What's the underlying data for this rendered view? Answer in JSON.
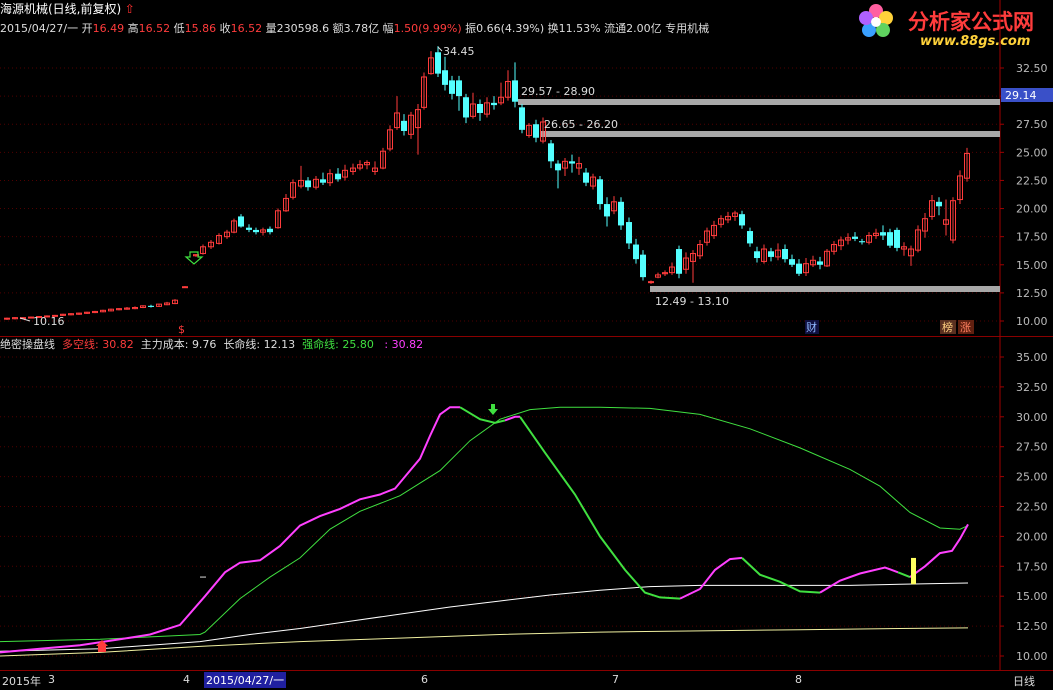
{
  "header": {
    "stock_title": "海源机械(日线,前复权)",
    "date": "2015/04/27/一",
    "open_label": "开",
    "open": "16.49",
    "high_label": "高",
    "high": "16.52",
    "low_label": "低",
    "low": "15.86",
    "close_label": "收",
    "close": "16.52",
    "volume_label": "量",
    "volume": "230598.6",
    "amount_label": "额",
    "amount": "3.78亿",
    "change_label": "幅",
    "change": "1.50(9.99%)",
    "amplitude_label": "振",
    "amplitude": "0.66(4.39%)",
    "turnover_label": "换",
    "turnover": "11.53%",
    "float_label": "流通",
    "float": "2.00亿",
    "sector": "专用机械"
  },
  "logo": {
    "text": "分析家公式网",
    "url": "www.88gs.com"
  },
  "main_chart": {
    "price_ticks": [
      "32.50",
      "30.00",
      "27.50",
      "25.00",
      "22.50",
      "20.00",
      "17.50",
      "15.00",
      "12.50",
      "10.00"
    ],
    "current_price_tag": "29.14",
    "annotations": {
      "high_label": "34.45",
      "low_label": "10.16",
      "zone1": "29.57 - 28.90",
      "zone2": "26.65 - 26.20",
      "zone3": "12.49 - 13.10"
    },
    "markers": {
      "cai": "财",
      "bang": "榜",
      "zhang": "涨",
      "dollar": "$"
    }
  },
  "indicator": {
    "name": "绝密操盘线",
    "duokong_label": "多空线:",
    "duokong_value": "30.82",
    "zhuli_label": "主力成本:",
    "zhuli_value": "9.76",
    "changming_label": "长命线:",
    "changming_value": "12.13",
    "qiangming_label": "强命线:",
    "qiangming_value": "25.80",
    "extra_label": ":",
    "extra_value": "30.82",
    "ticks": [
      "35.00",
      "32.50",
      "30.00",
      "27.50",
      "25.00",
      "22.50",
      "20.00",
      "17.50",
      "15.00",
      "12.50",
      "10.00"
    ]
  },
  "bottom_bar": {
    "year": "2015年",
    "months": [
      "3",
      "4",
      "6",
      "7",
      "8"
    ],
    "cursor_date": "2015/04/27/一",
    "period": "日线"
  },
  "colors": {
    "up": "#ff3c3c",
    "down": "#54ffff",
    "magenta": "#ff40ff",
    "green": "#40e040",
    "white": "#ffffff",
    "yellow": "#ffff60"
  }
}
